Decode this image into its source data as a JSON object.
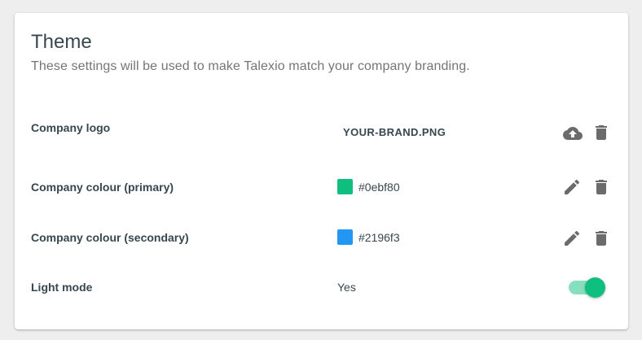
{
  "theme": {
    "title": "Theme",
    "subtitle": "These settings will be used to make Talexio match your company branding."
  },
  "rows": {
    "logo": {
      "label": "Company logo",
      "file_name": "YOUR-BRAND.PNG",
      "actions": [
        "cloud-upload-icon",
        "delete-icon"
      ]
    },
    "primary": {
      "label": "Company colour (primary)",
      "value": "#0ebf80",
      "swatch_color": "#0ebf80",
      "actions": [
        "edit-icon",
        "delete-icon"
      ]
    },
    "secondary": {
      "label": "Company colour (secondary)",
      "value": "#2196f3",
      "swatch_color": "#2196f3",
      "actions": [
        "edit-icon",
        "delete-icon"
      ]
    },
    "light_mode": {
      "label": "Light mode",
      "value": "Yes",
      "toggle_on": true
    }
  },
  "colors": {
    "accent": "#0ebf80",
    "icon": "#6b6b6b"
  }
}
